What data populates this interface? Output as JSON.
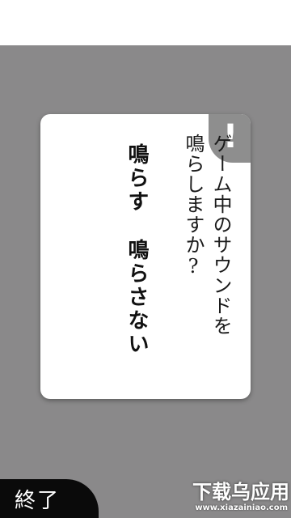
{
  "dialog": {
    "alert_icon": "exclamation-icon",
    "alert_mark": "!",
    "question_lines": [
      "ゲーム中のサウンドを",
      "鳴らしますか?"
    ],
    "option_on": "鳴らす",
    "option_off": "鳴らさない"
  },
  "footer": {
    "end_label": "終了",
    "watermark_main": "下载乌应用",
    "watermark_sub": "www.xiazainiao.com"
  },
  "colors": {
    "backdrop": "#8a898a",
    "card": "#ffffff",
    "corner_tab": "#8e8e8e",
    "end_button": "#0a0a0a"
  }
}
